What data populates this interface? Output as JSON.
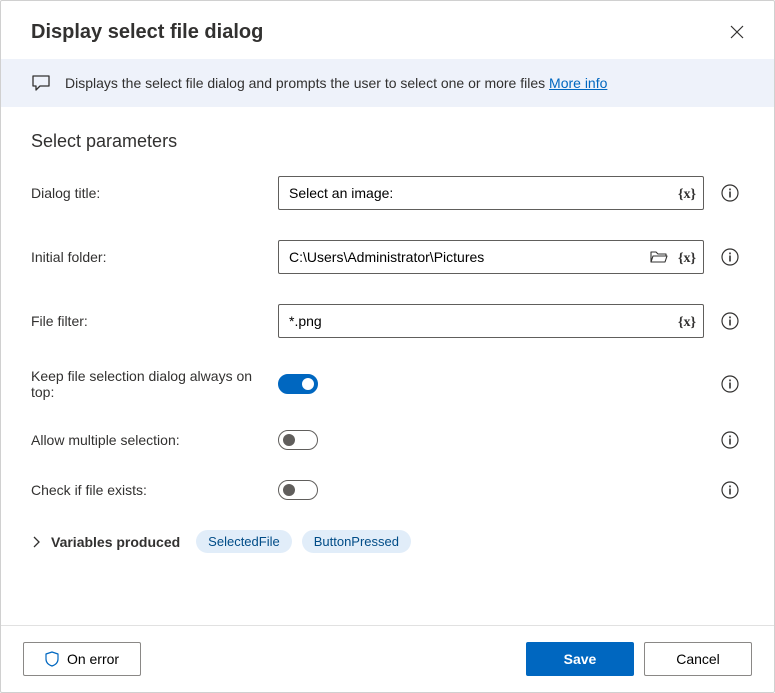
{
  "title": "Display select file dialog",
  "banner": {
    "text": "Displays the select file dialog and prompts the user to select one or more files ",
    "link": "More info"
  },
  "section_heading": "Select parameters",
  "fields": {
    "dialog_title": {
      "label": "Dialog title:",
      "value": "Select an image:"
    },
    "initial_folder": {
      "label": "Initial folder:",
      "value": "C:\\Users\\Administrator\\Pictures"
    },
    "file_filter": {
      "label": "File filter:",
      "value": "*.png"
    },
    "always_on_top": {
      "label": "Keep file selection dialog always on top:",
      "value": true
    },
    "allow_multiple": {
      "label": "Allow multiple selection:",
      "value": false
    },
    "check_exists": {
      "label": "Check if file exists:",
      "value": false
    }
  },
  "variables": {
    "label": "Variables produced",
    "items": [
      "SelectedFile",
      "ButtonPressed"
    ]
  },
  "footer": {
    "on_error": "On error",
    "save": "Save",
    "cancel": "Cancel"
  }
}
